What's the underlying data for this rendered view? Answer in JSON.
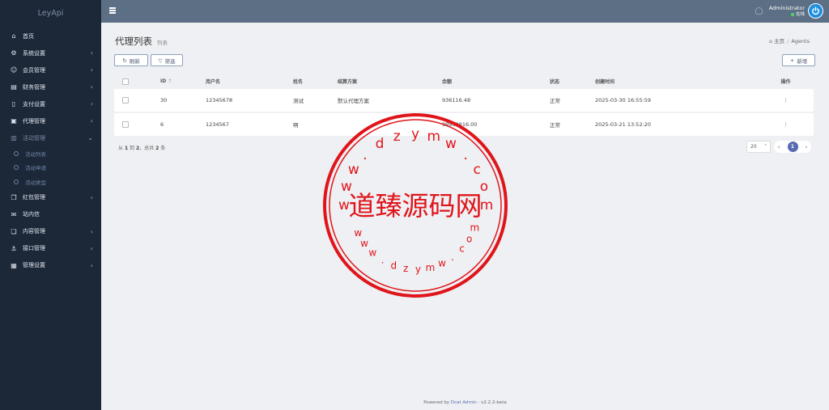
{
  "app": {
    "logo": "LeyApi"
  },
  "sidebar": {
    "items": [
      {
        "label": "首页",
        "icon": "home-icon",
        "glyph": "⌂",
        "chevron": ""
      },
      {
        "label": "系统设置",
        "icon": "cogs-icon",
        "glyph": "⚙",
        "chevron": "‹"
      },
      {
        "label": "会员管理",
        "icon": "user-icon",
        "glyph": "☺",
        "chevron": "‹"
      },
      {
        "label": "财务管理",
        "icon": "database-icon",
        "glyph": "▤",
        "chevron": "‹"
      },
      {
        "label": "支付设置",
        "icon": "bookmark-icon",
        "glyph": "▯",
        "chevron": "‹"
      },
      {
        "label": "代理管理",
        "icon": "portrait-icon",
        "glyph": "▣",
        "chevron": "‹"
      },
      {
        "label": "活动管理",
        "icon": "gift-icon",
        "glyph": "▥",
        "chevron": "⌄"
      }
    ],
    "sub_items": [
      {
        "label": "活动列表"
      },
      {
        "label": "活动申请"
      },
      {
        "label": "活动类型"
      }
    ],
    "items_after": [
      {
        "label": "红包管理",
        "icon": "clone-icon",
        "glyph": "❐",
        "chevron": "‹"
      },
      {
        "label": "站内信",
        "icon": "envelope-icon",
        "glyph": "✉",
        "chevron": ""
      },
      {
        "label": "内容管理",
        "icon": "copy-icon",
        "glyph": "❏",
        "chevron": "‹"
      },
      {
        "label": "接口管理",
        "icon": "anchor-icon",
        "glyph": "⚓",
        "chevron": "‹"
      },
      {
        "label": "管理设置",
        "icon": "id-card-icon",
        "glyph": "▦",
        "chevron": "‹"
      }
    ]
  },
  "topbar": {
    "user_name": "Administrator",
    "user_status": "在线"
  },
  "page": {
    "title": "代理列表",
    "subtitle": "列表",
    "breadcrumb_home": "主页",
    "breadcrumb_current": "Agents"
  },
  "toolbar": {
    "refresh": "刷新",
    "filter": "筛选",
    "add": "新增"
  },
  "table": {
    "headers": {
      "id": "ID",
      "username": "用户名",
      "name": "姓名",
      "plan": "结算方案",
      "balance": "余额",
      "status": "状态",
      "created": "创建时间",
      "actions": "操作"
    },
    "rows": [
      {
        "id": "30",
        "username": "12345678",
        "name": "测试",
        "plan": "默认代理方案",
        "balance": "936116.48",
        "status": "正常",
        "created": "2025-03-30 16:55:59"
      },
      {
        "id": "6",
        "username": "1234567",
        "name": "啊",
        "plan": "",
        "balance": "99999916.00",
        "status": "正常",
        "created": "2025-03-21 13:52:20"
      }
    ]
  },
  "pagination": {
    "summary_prefix": "从",
    "from": "1",
    "mid1": "到",
    "to": "2",
    "mid2": "，总共",
    "total": "2",
    "suffix": "条",
    "page_size": "20",
    "current_page": "1"
  },
  "footer": {
    "prefix": "Powered by",
    "link": "Dcat Admin",
    "version": "·  v2.2.2-beta"
  },
  "watermark": {
    "center": "道臻源码网",
    "ring": "www.dzymw.com",
    "color": "#e0151b"
  }
}
